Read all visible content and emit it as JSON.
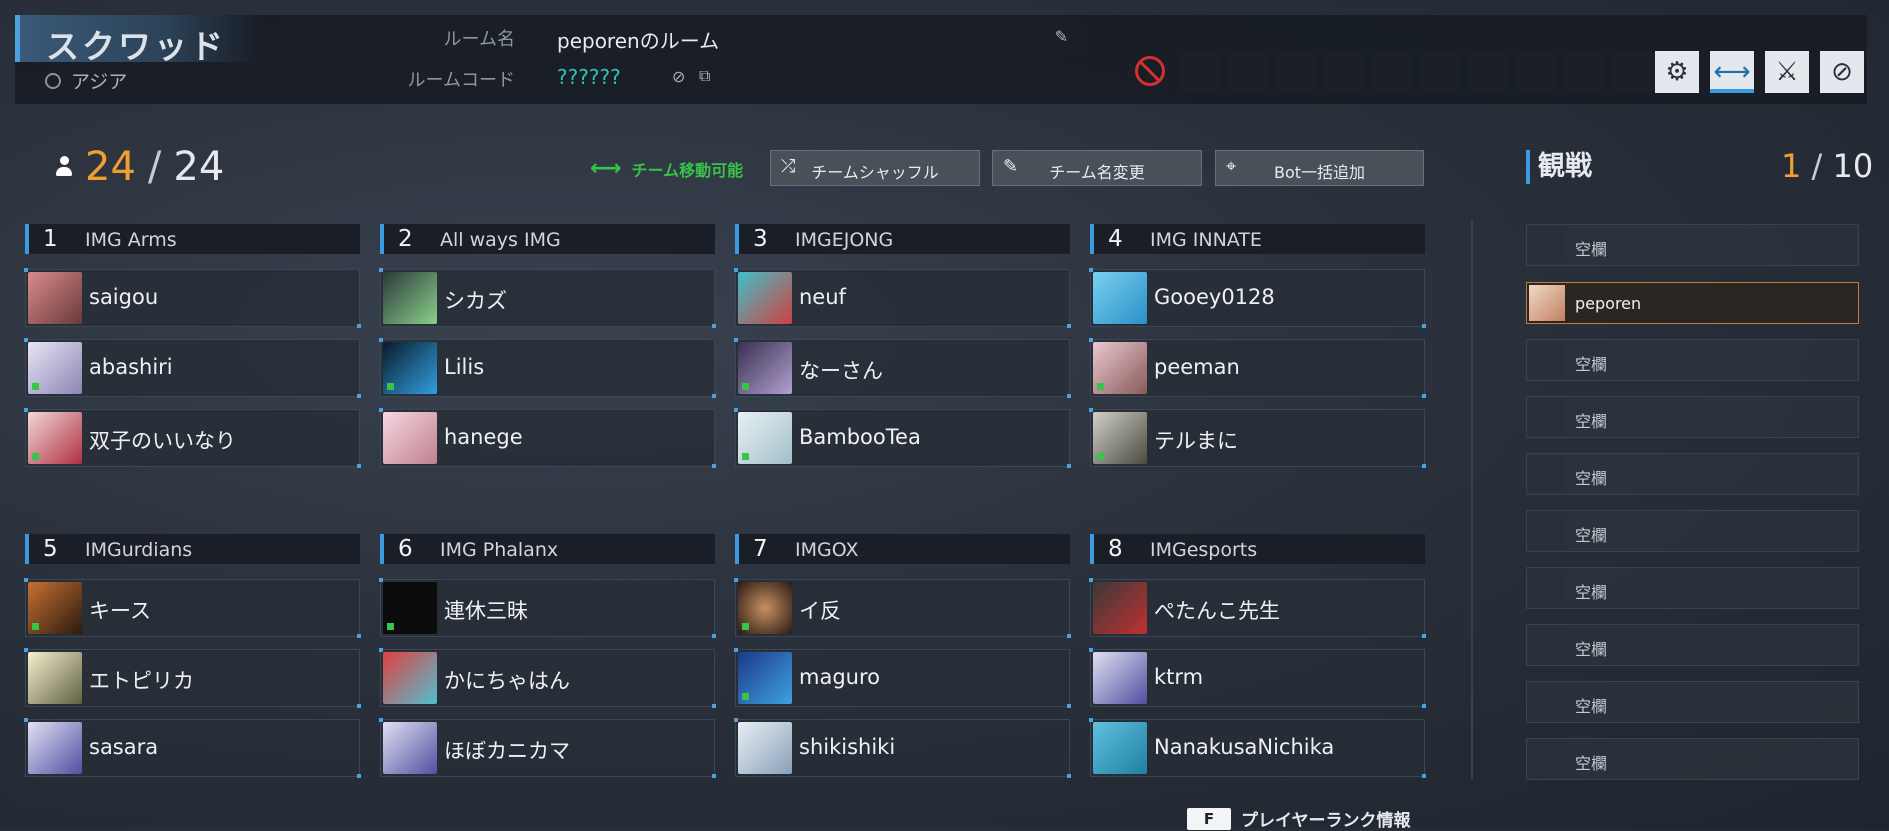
{
  "header": {
    "mode": "スクワッド",
    "region": "アジア",
    "room_name_label": "ルーム名",
    "room_name_value": "peporenのルーム",
    "room_code_label": "ルームコード",
    "room_code_value": "??????"
  },
  "counts": {
    "current": "24",
    "sep": "/",
    "total": "24"
  },
  "actions": {
    "move_ok": "チーム移動可能",
    "shuffle": "チームシャッフル",
    "rename": "チーム名変更",
    "add_bots": "Bot一括追加"
  },
  "teams": [
    {
      "num": "1",
      "name": "IMG Arms",
      "players": [
        "saigou",
        "abashiri",
        "双子のいいなり"
      ]
    },
    {
      "num": "2",
      "name": "All ways IMG",
      "players": [
        "シカズ",
        "Lilis",
        "hanege"
      ]
    },
    {
      "num": "3",
      "name": "IMGEJONG",
      "players": [
        "neuf",
        "なーさん",
        "BambooTea"
      ]
    },
    {
      "num": "4",
      "name": "IMG INNATE",
      "players": [
        "Gooey0128",
        "peeman",
        "テルまに"
      ]
    },
    {
      "num": "5",
      "name": "IMGurdians",
      "players": [
        "キース",
        "エトピリカ",
        "sasara"
      ]
    },
    {
      "num": "6",
      "name": "IMG Phalanx",
      "players": [
        "連休三昧",
        "かにちゃはん",
        "ほぼカニカマ"
      ]
    },
    {
      "num": "7",
      "name": "IMGOX",
      "players": [
        "イ反",
        "maguro",
        "shikishiki"
      ]
    },
    {
      "num": "8",
      "name": "IMGesports",
      "players": [
        "ぺたんこ先生",
        "ktrm",
        "NanakusaNichika"
      ]
    }
  ],
  "spectate": {
    "title": "観戦",
    "current": "1",
    "sep": "/",
    "total": "10",
    "slots": [
      "空欄",
      "peporen",
      "空欄",
      "空欄",
      "空欄",
      "空欄",
      "空欄",
      "空欄",
      "空欄",
      "空欄"
    ]
  },
  "footer": {
    "key": "F",
    "label": "プレイヤーランク情報"
  },
  "colors": {
    "accent": "#3c9be0",
    "count": "#f0a030",
    "ok": "#37c24a",
    "noentry": "#d3302f"
  }
}
